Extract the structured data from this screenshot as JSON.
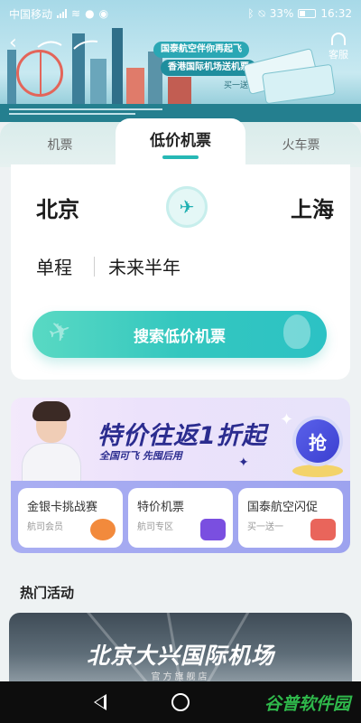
{
  "status_bar": {
    "carrier": "中国移动",
    "battery": "33%",
    "time": "16:32"
  },
  "banner": {
    "line1": "国泰航空伴你再起飞",
    "line2": "香港国际机场送机票",
    "line3": "买一送一",
    "service_label": "客服"
  },
  "tabs": [
    {
      "label": "机票"
    },
    {
      "label": "低价机票"
    },
    {
      "label": "火车票"
    }
  ],
  "search": {
    "from_city": "北京",
    "to_city": "上海",
    "trip_type": "单程",
    "period": "未来半年",
    "button_label": "搜索低价机票"
  },
  "deal": {
    "title": "特价往返1折起",
    "subtitle": "全国可飞 先囤后用",
    "grab_label": "抢"
  },
  "mini_cards": [
    {
      "title": "金银卡挑战赛",
      "sub": "航司会员",
      "color": "#f28a3c"
    },
    {
      "title": "特价机票",
      "sub": "航司专区",
      "color": "#7a4fe0"
    },
    {
      "title": "国泰航空闪促",
      "sub": "买一送一",
      "color": "#e9655b"
    }
  ],
  "hot": {
    "section_title": "热门活动",
    "card_title": "北京大兴国际机场",
    "card_subtitle": "官方旗舰店"
  },
  "watermark": "谷普软件园"
}
